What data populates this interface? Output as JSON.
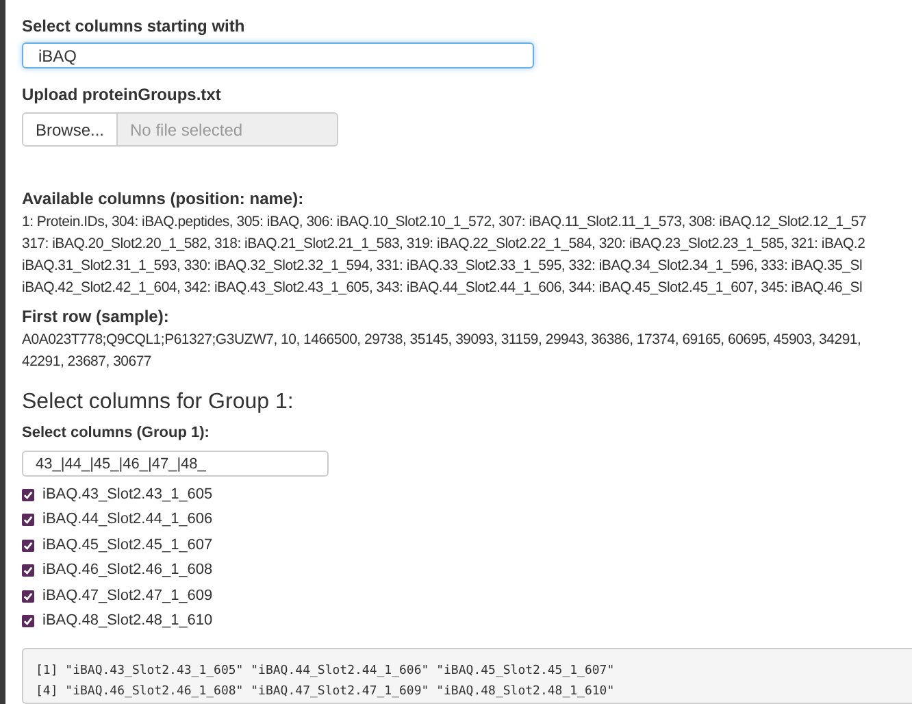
{
  "prefix_field": {
    "label": "Select columns starting with",
    "value": "iBAQ"
  },
  "upload": {
    "label": "Upload proteinGroups.txt",
    "button": "Browse...",
    "placeholder": "No file selected"
  },
  "available_columns": {
    "label": "Available columns (position: name):",
    "lines": [
      "1: Protein.IDs, 304: iBAQ.peptides, 305: iBAQ, 306: iBAQ.10_Slot2.10_1_572, 307: iBAQ.11_Slot2.11_1_573, 308: iBAQ.12_Slot2.12_1_57",
      "317: iBAQ.20_Slot2.20_1_582, 318: iBAQ.21_Slot2.21_1_583, 319: iBAQ.22_Slot2.22_1_584, 320: iBAQ.23_Slot2.23_1_585, 321: iBAQ.2",
      "iBAQ.31_Slot2.31_1_593, 330: iBAQ.32_Slot2.32_1_594, 331: iBAQ.33_Slot2.33_1_595, 332: iBAQ.34_Slot2.34_1_596, 333: iBAQ.35_Sl",
      "iBAQ.42_Slot2.42_1_604, 342: iBAQ.43_Slot2.43_1_605, 343: iBAQ.44_Slot2.44_1_606, 344: iBAQ.45_Slot2.45_1_607, 345: iBAQ.46_Sl"
    ]
  },
  "first_row": {
    "label": "First row (sample):",
    "lines": [
      "A0A023T778;Q9CQL1;P61327;G3UZW7, 10, 1466500, 29738, 35145, 39093, 31159, 29943, 36386, 17374, 69165, 60695, 45903, 34291,",
      "42291, 23687, 30677"
    ]
  },
  "group": {
    "heading": "Select columns for Group 1:",
    "label": "Select columns (Group 1):",
    "value": "43_|44_|45_|46_|47_|48_",
    "options": [
      {
        "label": "iBAQ.43_Slot2.43_1_605",
        "checked": true
      },
      {
        "label": "iBAQ.44_Slot2.44_1_606",
        "checked": true
      },
      {
        "label": "iBAQ.45_Slot2.45_1_607",
        "checked": true
      },
      {
        "label": "iBAQ.46_Slot2.46_1_608",
        "checked": true
      },
      {
        "label": "iBAQ.47_Slot2.47_1_609",
        "checked": true
      },
      {
        "label": "iBAQ.48_Slot2.48_1_610",
        "checked": true
      }
    ]
  },
  "output": {
    "lines": [
      "[1] \"iBAQ.43_Slot2.43_1_605\" \"iBAQ.44_Slot2.44_1_606\" \"iBAQ.45_Slot2.45_1_607\"",
      "[4] \"iBAQ.46_Slot2.46_1_608\" \"iBAQ.47_Slot2.47_1_609\" \"iBAQ.48_Slot2.48_1_610\""
    ]
  }
}
